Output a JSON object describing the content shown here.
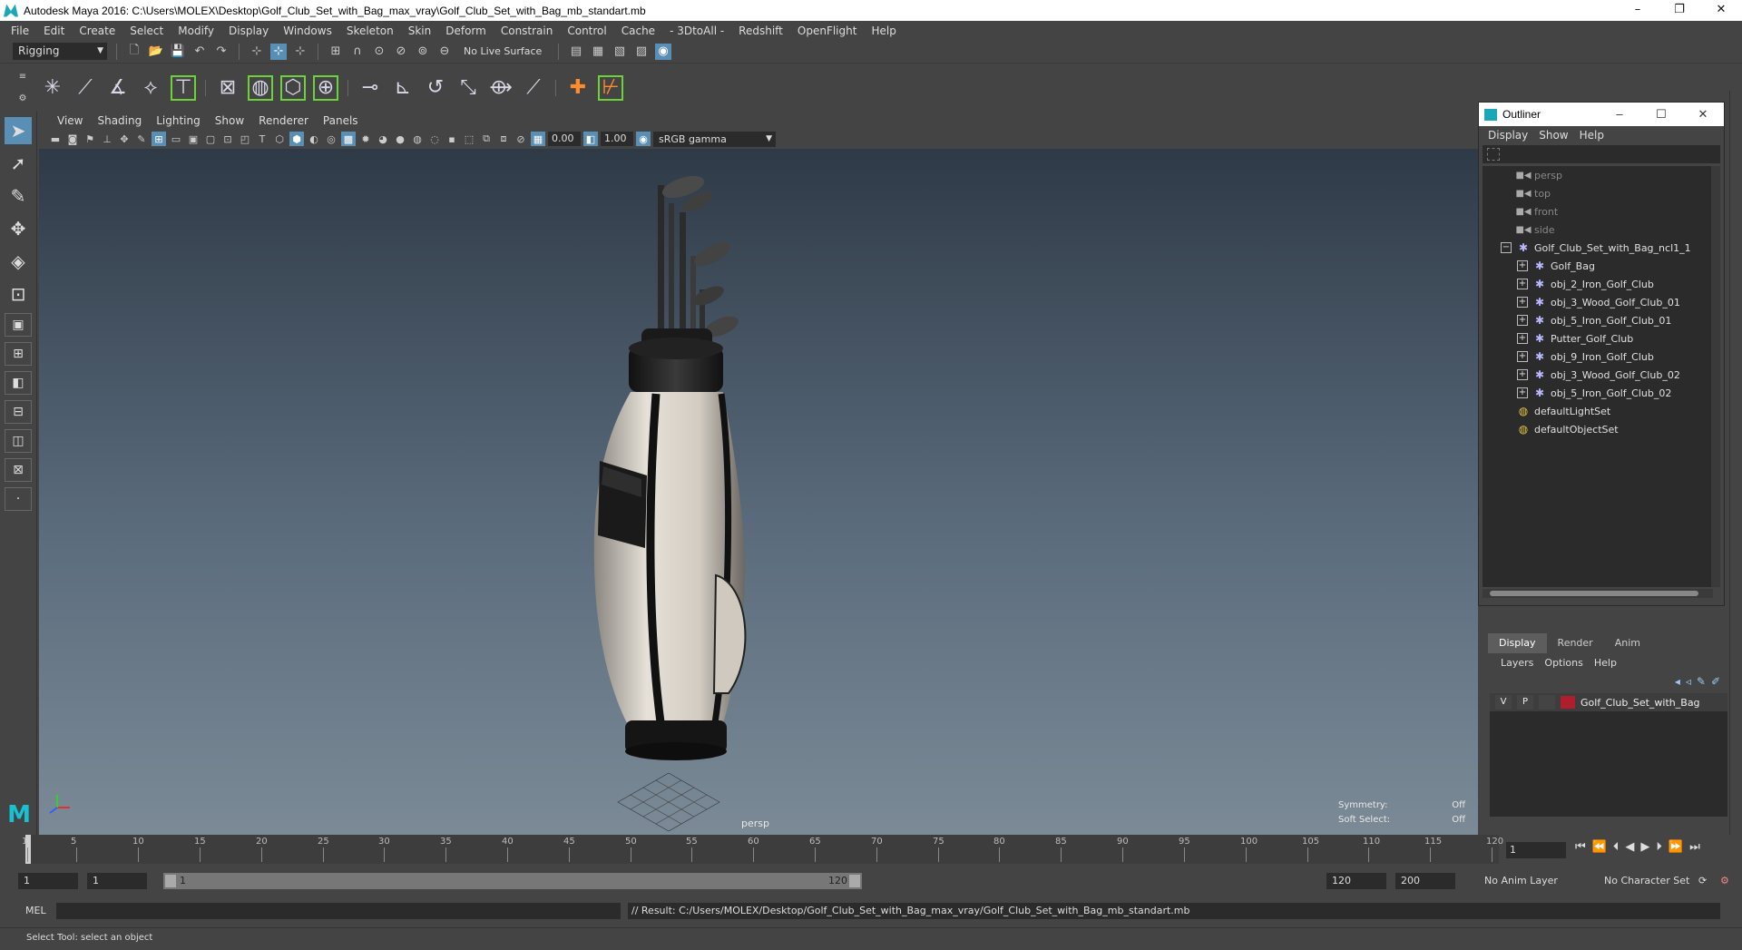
{
  "window": {
    "title": "Autodesk Maya 2016: C:\\Users\\MOLEX\\Desktop\\Golf_Club_Set_with_Bag_max_vray\\Golf_Club_Set_with_Bag_mb_standart.mb",
    "minimize": "–",
    "restore": "❐",
    "close": "✕"
  },
  "menubar": [
    "File",
    "Edit",
    "Create",
    "Select",
    "Modify",
    "Display",
    "Windows",
    "Skeleton",
    "Skin",
    "Deform",
    "Constrain",
    "Control",
    "Cache",
    "- 3DtoAll -",
    "Redshift",
    "OpenFlight",
    "Help"
  ],
  "statusline": {
    "mode": "Rigging",
    "live_surface": "No Live Surface"
  },
  "panel": {
    "menu": [
      "View",
      "Shading",
      "Lighting",
      "Show",
      "Renderer",
      "Panels"
    ],
    "near_value": "0.00",
    "far_value": "1.00",
    "color_space": "sRGB gamma"
  },
  "viewport": {
    "camera_label": "persp",
    "hud": [
      {
        "label": "Symmetry:",
        "value": "Off"
      },
      {
        "label": "Soft Select:",
        "value": "Off"
      }
    ]
  },
  "outliner": {
    "title": "Outliner",
    "menu": [
      "Display",
      "Show",
      "Help"
    ],
    "items": [
      {
        "name": "persp",
        "type": "camera",
        "depth": 1
      },
      {
        "name": "top",
        "type": "camera",
        "depth": 1
      },
      {
        "name": "front",
        "type": "camera",
        "depth": 1
      },
      {
        "name": "side",
        "type": "camera",
        "depth": 1
      },
      {
        "name": "Golf_Club_Set_with_Bag_ncl1_1",
        "type": "group-root",
        "depth": 0
      },
      {
        "name": "Golf_Bag",
        "type": "group",
        "depth": 1
      },
      {
        "name": "obj_2_Iron_Golf_Club",
        "type": "group",
        "depth": 1
      },
      {
        "name": "obj_3_Wood_Golf_Club_01",
        "type": "group",
        "depth": 1
      },
      {
        "name": "obj_5_Iron_Golf_Club_01",
        "type": "group",
        "depth": 1
      },
      {
        "name": "Putter_Golf_Club",
        "type": "group",
        "depth": 1
      },
      {
        "name": "obj_9_Iron_Golf_Club",
        "type": "group",
        "depth": 1
      },
      {
        "name": "obj_3_Wood_Golf_Club_02",
        "type": "group",
        "depth": 1
      },
      {
        "name": "obj_5_Iron_Golf_Club_02",
        "type": "group",
        "depth": 1
      },
      {
        "name": "defaultLightSet",
        "type": "set",
        "depth": 0
      },
      {
        "name": "defaultObjectSet",
        "type": "set",
        "depth": 0
      }
    ]
  },
  "layer_editor": {
    "tabs": [
      "Display",
      "Render",
      "Anim"
    ],
    "menu": [
      "Layers",
      "Options",
      "Help"
    ],
    "layers": [
      {
        "v": "V",
        "p": "P",
        "name": "Golf_Club_Set_with_Bag",
        "color": "#b01e2d"
      }
    ]
  },
  "timeslider": {
    "ticks": [
      "1",
      "5",
      "10",
      "15",
      "20",
      "25",
      "30",
      "35",
      "40",
      "45",
      "50",
      "55",
      "60",
      "65",
      "70",
      "75",
      "80",
      "85",
      "90",
      "95",
      "100",
      "105",
      "110",
      "115",
      "120"
    ],
    "current_frame": "1"
  },
  "rangeslider": {
    "start": "1",
    "playback_start": "1",
    "range_start_label": "1",
    "range_end_label": "120",
    "playback_end": "120",
    "end": "200",
    "anim_layer": "No Anim Layer",
    "character_set": "No Character Set"
  },
  "cmdline": {
    "lang": "MEL",
    "result": "// Result: C:/Users/MOLEX/Desktop/Golf_Club_Set_with_Bag_max_vray/Golf_Club_Set_with_Bag_mb_standart.mb"
  },
  "helpline": "Select Tool: select an object"
}
